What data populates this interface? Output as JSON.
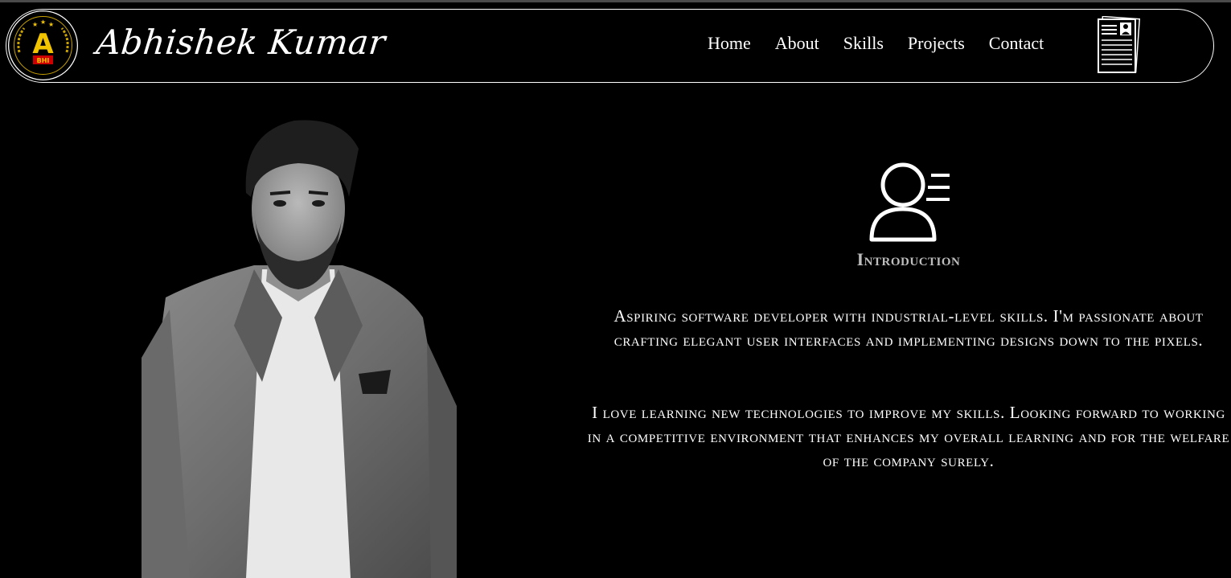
{
  "brand": {
    "name": "Abhishek Kumar",
    "logo_letter": "A",
    "logo_sub": "BHI"
  },
  "nav": {
    "items": [
      "Home",
      "About",
      "Skills",
      "Projects",
      "Contact"
    ]
  },
  "icons": {
    "resume": "resume-document-icon",
    "intro": "user-profile-icon"
  },
  "intro": {
    "heading": "Introduction",
    "paragraph1": "Aspiring software developer with industrial-level skills. I'm passionate about crafting elegant user interfaces and implementing designs down to the pixels.",
    "paragraph2": "I love learning new technologies to improve my skills. Looking forward to working in a competitive environment that enhances my overall learning and for the welfare of the company surely."
  },
  "colors": {
    "background": "#000000",
    "text": "#ffffff",
    "logo_gold": "#f2c400",
    "heading_gray": "#bdbdbd"
  }
}
